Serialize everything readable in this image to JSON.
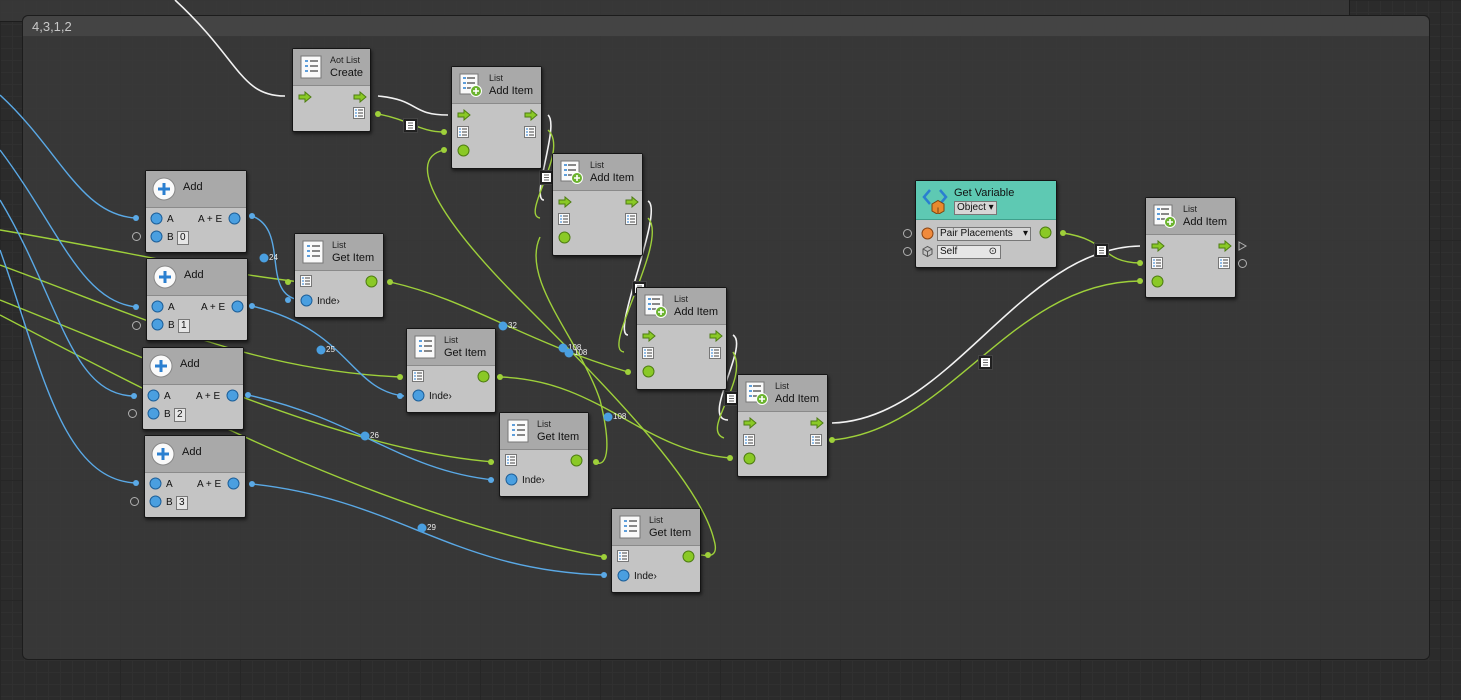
{
  "group": {
    "title": "4,3,1,2"
  },
  "colors": {
    "flow": "#f2f2f2",
    "list": "#9ed03a",
    "number": "#5aa9e6",
    "node_body": "#c4c4c4",
    "node_header": "#a9a9a9",
    "variable_header": "#5ec9b3"
  },
  "icons": {
    "list": "list-icon",
    "list_add": "list-add-icon",
    "add": "plus-circle-icon",
    "variable": "variable-icon",
    "flow": "flow-arrow-icon",
    "object": "cube-icon"
  },
  "nodes": {
    "aot_create": {
      "subtitle": "Aot List",
      "title": "Create"
    },
    "add_item_1": {
      "subtitle": "List",
      "title": "Add Item"
    },
    "add_item_2": {
      "subtitle": "List",
      "title": "Add Item"
    },
    "add_item_3": {
      "subtitle": "List",
      "title": "Add Item"
    },
    "add_item_4": {
      "subtitle": "List",
      "title": "Add Item"
    },
    "add_item_5": {
      "subtitle": "List",
      "title": "Add Item"
    },
    "get_item_1": {
      "subtitle": "List",
      "title": "Get Item",
      "index_label": "Inde›"
    },
    "get_item_2": {
      "subtitle": "List",
      "title": "Get Item",
      "index_label": "Inde›"
    },
    "get_item_3": {
      "subtitle": "List",
      "title": "Get Item",
      "index_label": "Inde›"
    },
    "get_item_4": {
      "subtitle": "List",
      "title": "Get Item",
      "index_label": "Inde›"
    },
    "add_1": {
      "title": "Add",
      "a_label": "A",
      "b_label": "B",
      "out_label": "A + E",
      "b_value": "0"
    },
    "add_2": {
      "title": "Add",
      "a_label": "A",
      "b_label": "B",
      "out_label": "A + E",
      "b_value": "1"
    },
    "add_3": {
      "title": "Add",
      "a_label": "A",
      "b_label": "B",
      "out_label": "A + E",
      "b_value": "2"
    },
    "add_4": {
      "title": "Add",
      "a_label": "A",
      "b_label": "B",
      "out_label": "A + E",
      "b_value": "3"
    },
    "get_variable": {
      "title": "Get Variable",
      "kind": "Object",
      "name": "Pair Placements",
      "target": "Self"
    }
  },
  "wire_labels": {
    "w24": "24",
    "w25": "25",
    "w26": "26",
    "w29": "29",
    "w32": "32",
    "w108a": "108",
    "w108b": "108",
    "w108c": "108"
  }
}
